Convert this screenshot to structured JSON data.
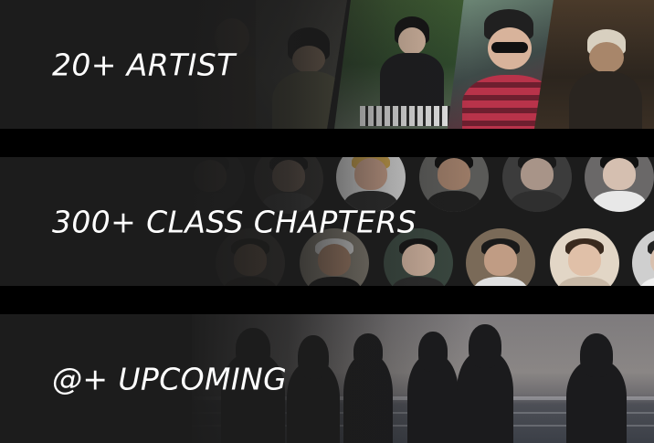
{
  "bands": [
    {
      "label": "20+ ARTIST"
    },
    {
      "label": "300+ CLASS CHAPTERS"
    },
    {
      "label": "@+ UPCOMING"
    }
  ],
  "colors": {
    "page_background": "#000000",
    "band_background": "#1c1c1c",
    "label_text": "#ffffff"
  }
}
